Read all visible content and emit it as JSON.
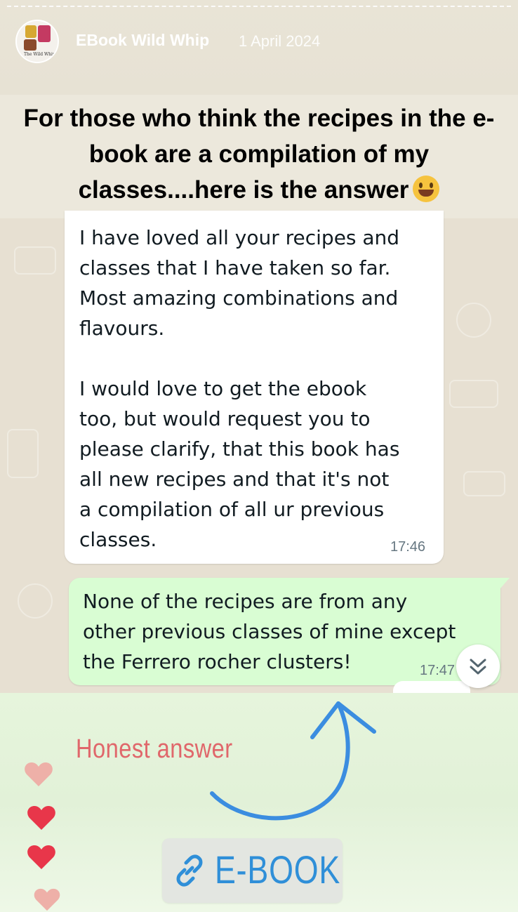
{
  "story": {
    "account_name": "EBook Wild Whip",
    "posted_date": "1 April 2024",
    "avatar_text": "The Wild Whip",
    "caption": "For those who think the recipes in the e-book are a compilation of my classes....here is the answer"
  },
  "chat": {
    "incoming": {
      "text": "I have loved all your recipes and\nclasses that I have taken so far.\nMost amazing combinations and\nflavours.\n\nI would love to get the ebook\ntoo, but would request you to\nplease clarify, that this book has\nall new recipes and  that it's not\na compilation of all ur previous\nclasses.",
      "time": "17:46"
    },
    "outgoing": {
      "text": "None of the recipes are from any\nother previous classes of mine except\nthe Ferrero rocher clusters!",
      "time": "17:47"
    }
  },
  "stickers": {
    "honest_text": "Honest answer",
    "link_label": "E-BOOK",
    "colors": {
      "honest": "#e0676b",
      "link": "#2f8fd8",
      "heart_red": "#e8364a",
      "heart_pink": "#eeb0a8",
      "outgoing_bubble": "#d9fdd3"
    }
  },
  "icons": [
    "link-icon",
    "chevrons-down-icon",
    "heart-icon",
    "smile-emoji-icon",
    "curved-arrow-icon"
  ]
}
